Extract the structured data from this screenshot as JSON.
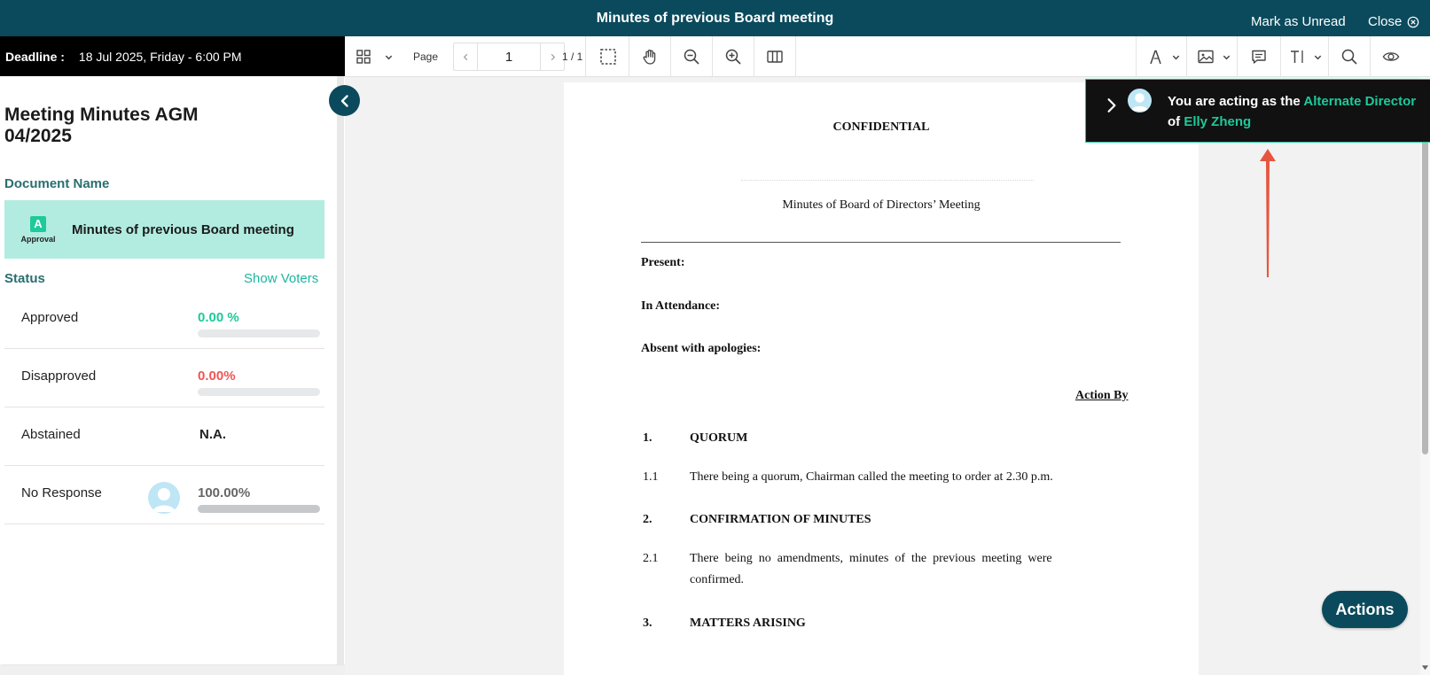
{
  "header": {
    "title": "Minutes of previous Board meeting",
    "mark_unread": "Mark as Unread",
    "close": "Close"
  },
  "deadline": {
    "label": "Deadline :",
    "value": "18 Jul 2025, Friday - 6:00 PM"
  },
  "meeting": {
    "title": "Meeting Minutes AGM 04/2025"
  },
  "document": {
    "section_label": "Document Name",
    "badge_letter": "A",
    "badge_caption": "Approval",
    "name": "Minutes of previous Board meeting"
  },
  "status": {
    "label": "Status",
    "show_voters": "Show Voters",
    "rows": [
      {
        "label": "Approved",
        "value": "0.00 %",
        "fraction": 0,
        "color": "#1ec99a"
      },
      {
        "label": "Disapproved",
        "value": "0.00%",
        "fraction": 0,
        "color": "#f05454"
      },
      {
        "label": "Abstained",
        "value": "N.A.",
        "color": "#222222"
      },
      {
        "label": "No Response",
        "value": "100.00%",
        "fraction": 1,
        "color": "#666666"
      }
    ]
  },
  "toolbar": {
    "page_label": "Page",
    "page_value": "1",
    "page_count": "1 / 1"
  },
  "pdf": {
    "confidential": "CONFIDENTIAL",
    "heading": "Minutes of Board of Directors’ Meeting",
    "present": "Present:",
    "in_attendance": "In Attendance:",
    "absent": "Absent with apologies:",
    "action_by": "Action By",
    "s1_num": "1.",
    "s1_title": "QUORUM",
    "s1_1_num": "1.1",
    "s1_1_text": "There being a quorum, Chairman called the meeting to order at 2.30 p.m.",
    "s2_num": "2.",
    "s2_title": "CONFIRMATION OF MINUTES",
    "s2_1_num": "2.1",
    "s2_1_line1": "There  being  no  amendments,  minutes  of  the  previous  meeting  were",
    "s2_1_line2": "confirmed.",
    "s3_num": "3.",
    "s3_title": "MATTERS ARISING"
  },
  "acting_notice": {
    "prefix": "You are acting as the ",
    "role": "Alternate Director",
    "of": "of ",
    "person": "Elly Zheng"
  },
  "actions_button": "Actions",
  "colors": {
    "brand": "#0a4a5c",
    "accent": "#1ec99a",
    "section_label": "#2a6e70",
    "annotation_arrow": "#e8553e"
  }
}
